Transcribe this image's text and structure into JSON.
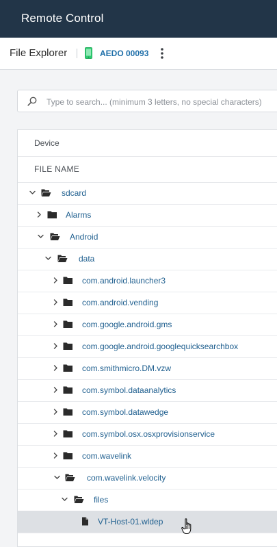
{
  "app": {
    "title": "Remote Control"
  },
  "subheader": {
    "title": "File Explorer",
    "device_id": "AEDO 00093"
  },
  "search": {
    "placeholder": "Type to search... (minimum 3 letters, no special characters)",
    "value": ""
  },
  "table": {
    "device_header": "Device",
    "file_name_header": "FILE NAME",
    "rows": [
      {
        "label": "sdcard",
        "type": "folder",
        "expanded": true
      },
      {
        "label": "Alarms",
        "type": "folder",
        "expanded": false
      },
      {
        "label": "Android",
        "type": "folder",
        "expanded": true
      },
      {
        "label": "data",
        "type": "folder",
        "expanded": true
      },
      {
        "label": "com.android.launcher3",
        "type": "folder",
        "expanded": false
      },
      {
        "label": "com.android.vending",
        "type": "folder",
        "expanded": false
      },
      {
        "label": "com.google.android.gms",
        "type": "folder",
        "expanded": false
      },
      {
        "label": "com.google.android.googlequicksearchbox",
        "type": "folder",
        "expanded": false
      },
      {
        "label": "com.smithmicro.DM.vzw",
        "type": "folder",
        "expanded": false
      },
      {
        "label": "com.symbol.dataanalytics",
        "type": "folder",
        "expanded": false
      },
      {
        "label": "com.symbol.datawedge",
        "type": "folder",
        "expanded": false
      },
      {
        "label": "com.symbol.osx.osxprovisionservice",
        "type": "folder",
        "expanded": false
      },
      {
        "label": "com.wavelink",
        "type": "folder",
        "expanded": false
      },
      {
        "label": "com.wavelink.velocity",
        "type": "folder",
        "expanded": true
      },
      {
        "label": "files",
        "type": "folder",
        "expanded": true
      },
      {
        "label": "VT-Host-01.wldep",
        "type": "file",
        "selected": true
      }
    ]
  },
  "colors": {
    "topbar": "#223548",
    "link": "#1f5f8f",
    "accent_green": "#2ecc71"
  }
}
